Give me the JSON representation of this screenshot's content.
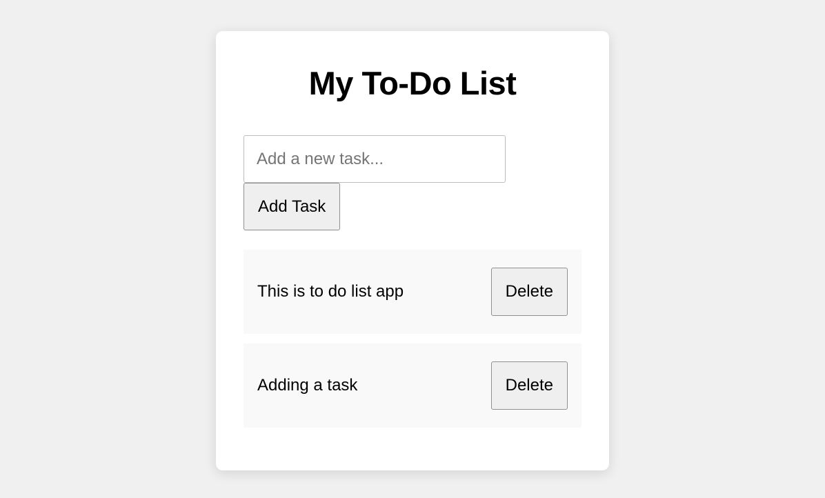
{
  "header": {
    "title": "My To-Do List"
  },
  "input": {
    "placeholder": "Add a new task...",
    "value": ""
  },
  "buttons": {
    "add": "Add Task",
    "delete": "Delete"
  },
  "tasks": [
    {
      "text": "This is to do list app"
    },
    {
      "text": "Adding a task"
    }
  ]
}
